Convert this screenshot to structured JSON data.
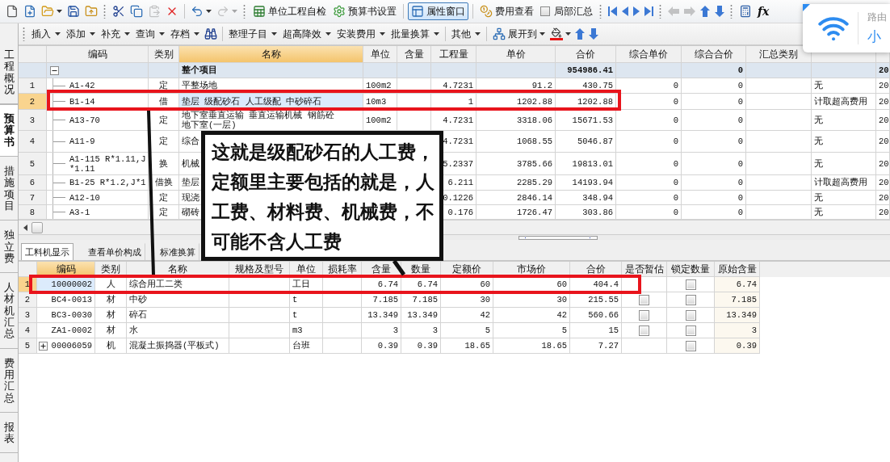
{
  "main_toolbar": [
    {
      "kind": "tool",
      "disabled": false
    },
    {
      "kind": "tool",
      "disabled": false
    },
    {
      "kind": "tool",
      "disabled": false,
      "menu": true
    },
    {
      "kind": "tool",
      "disabled": false
    },
    {
      "kind": "tool",
      "disabled": false
    },
    {
      "kind": "grip"
    },
    {
      "kind": "tool",
      "disabled": false
    },
    {
      "kind": "tool",
      "disabled": false
    },
    {
      "kind": "tool",
      "disabled": true
    },
    {
      "kind": "tool",
      "disabled": false
    },
    {
      "kind": "divider"
    },
    {
      "kind": "tool",
      "disabled": false,
      "menu": true
    },
    {
      "kind": "tool",
      "disabled": true,
      "menu": true
    },
    {
      "kind": "grip"
    },
    {
      "kind": "labeled",
      "label": "单位工程自检"
    },
    {
      "kind": "labeled",
      "label": "预算书设置"
    },
    {
      "kind": "divider"
    },
    {
      "kind": "toggle",
      "label": "属性窗口",
      "selected": true
    },
    {
      "kind": "divider"
    },
    {
      "kind": "labeled",
      "label": "费用查看"
    },
    {
      "kind": "check",
      "label": "局部汇总",
      "checked": false
    },
    {
      "kind": "grip"
    },
    {
      "kind": "tool",
      "disabled": false
    },
    {
      "kind": "tool",
      "disabled": false
    },
    {
      "kind": "tool",
      "disabled": false
    },
    {
      "kind": "tool",
      "disabled": false
    },
    {
      "kind": "grip"
    },
    {
      "kind": "tool",
      "disabled": true
    },
    {
      "kind": "tool",
      "disabled": true
    },
    {
      "kind": "tool",
      "disabled": false
    },
    {
      "kind": "tool",
      "disabled": false
    },
    {
      "kind": "grip"
    },
    {
      "kind": "tool",
      "disabled": false
    },
    {
      "kind": "text",
      "label": "fx"
    }
  ],
  "sub_toolbar": [
    {
      "kind": "grip"
    },
    {
      "kind": "menu",
      "label": "插入"
    },
    {
      "kind": "menu",
      "label": "添加"
    },
    {
      "kind": "menu",
      "label": "补充"
    },
    {
      "kind": "menu",
      "label": "查询"
    },
    {
      "kind": "menu",
      "label": "存档"
    },
    {
      "kind": "tool",
      "disabled": false
    },
    {
      "kind": "divider"
    },
    {
      "kind": "menu",
      "label": "整理子目"
    },
    {
      "kind": "menu",
      "label": "超高降效"
    },
    {
      "kind": "menu",
      "label": "安装费用"
    },
    {
      "kind": "menu",
      "label": "批量换算"
    },
    {
      "kind": "divider"
    },
    {
      "kind": "menu",
      "label": "其他"
    },
    {
      "kind": "divider"
    },
    {
      "kind": "labeled",
      "label": "展开到",
      "menu": true
    },
    {
      "kind": "tool",
      "disabled": false,
      "menu": true
    },
    {
      "kind": "tool",
      "disabled": false
    },
    {
      "kind": "tool",
      "disabled": false
    }
  ],
  "side_tabs": [
    {
      "label": "工程概况",
      "selected": false
    },
    {
      "label": "预算书",
      "selected": true
    },
    {
      "label": "措施项目",
      "selected": false
    },
    {
      "label": "独立费",
      "selected": false
    },
    {
      "label": "人材机汇总",
      "selected": false
    },
    {
      "label": "费用汇总",
      "selected": false
    },
    {
      "label": "报表",
      "selected": false
    }
  ],
  "budget_table": {
    "columns": [
      {
        "label": "编码",
        "selected": false
      },
      {
        "label": "类别",
        "selected": false
      },
      {
        "label": "名称",
        "selected": true
      },
      {
        "label": "单位",
        "selected": false
      },
      {
        "label": "含量",
        "selected": false
      },
      {
        "label": "工程量",
        "selected": false
      },
      {
        "label": "单价",
        "selected": false
      },
      {
        "label": "合价",
        "selected": false
      },
      {
        "label": "综合单价",
        "selected": false
      },
      {
        "label": "综合合价",
        "selected": false
      },
      {
        "label": "汇总类别",
        "selected": false
      }
    ],
    "summary_row": {
      "expanded": true,
      "name": "整个项目",
      "total": "954986.41",
      "comp_total": "0",
      "column_13": "20"
    },
    "rows": [
      {
        "no": "1",
        "selected": false,
        "code": "A1-42",
        "type": "定",
        "name": "平整场地",
        "unit": "100m2",
        "quantity": "4.7231",
        "price": "91.2",
        "total": "430.75",
        "comp_price": "0",
        "comp_total": "0",
        "column_12": "无",
        "column_13": "20"
      },
      {
        "no": "2",
        "selected": true,
        "code": "B1-14",
        "type": "借",
        "name": "垫层 级配砂石 人工级配 中砂碎石",
        "unit": "10m3",
        "quantity": "1",
        "price": "1202.88",
        "total": "1202.88",
        "comp_price": "0",
        "comp_total": "0",
        "column_12": "计取超高费用",
        "column_13": "20"
      },
      {
        "no": "3",
        "selected": false,
        "code": "A13-70",
        "type": "定",
        "name": "地下室垂直运输 垂直运输机械 钢筋砼地下室(一层)",
        "unit": "100m2",
        "quantity": "4.7231",
        "price": "3318.06",
        "total": "15671.53",
        "comp_price": "0",
        "comp_total": "0",
        "column_12": "无",
        "column_13": "20"
      },
      {
        "no": "4",
        "selected": false,
        "code": "A11-9",
        "type": "定",
        "name": "综合",
        "quantity": "4.7231",
        "price": "1068.55",
        "total": "5046.87",
        "comp_price": "0",
        "comp_total": "0",
        "column_12": "无",
        "column_13": "20"
      },
      {
        "no": "5",
        "selected": false,
        "code": "A1-115 R*1.11,J *1.11",
        "type": "换",
        "name": "机械",
        "quantity": "5.2337",
        "price": "3785.66",
        "total": "19813.01",
        "comp_price": "0",
        "comp_total": "0",
        "column_12": "无",
        "column_13": "20"
      },
      {
        "no": "6",
        "selected": false,
        "code": "B1-25 R*1.2,J*1",
        "type": "借换",
        "name": "垫层",
        "quantity": "6.211",
        "price": "2285.29",
        "total": "14193.94",
        "comp_price": "0",
        "comp_total": "0",
        "column_12": "计取超高费用",
        "column_13": "20"
      },
      {
        "no": "7",
        "selected": false,
        "code": "A12-10",
        "type": "定",
        "name": "现浇",
        "quantity": "0.1226",
        "price": "2846.14",
        "total": "348.94",
        "comp_price": "0",
        "comp_total": "0",
        "column_12": "无",
        "column_13": "20"
      },
      {
        "no": "8",
        "selected": false,
        "code": "A3-1",
        "type": "定",
        "name": "砌砖",
        "quantity": "0.176",
        "price": "1726.47",
        "total": "303.86",
        "comp_price": "0",
        "comp_total": "0",
        "column_12": "无",
        "column_13": "20"
      }
    ]
  },
  "resource_table": {
    "tabs": [
      {
        "label": "工料机显示",
        "selected": true
      },
      {
        "label": "查看单价构成",
        "selected": false
      },
      {
        "label": "标准换算",
        "selected": false
      }
    ],
    "columns": [
      {
        "label": "编码",
        "selected": true
      },
      {
        "label": "类别",
        "selected": false
      },
      {
        "label": "名称",
        "selected": false
      },
      {
        "label": "规格及型号",
        "selected": false
      },
      {
        "label": "单位",
        "selected": false
      },
      {
        "label": "损耗率",
        "selected": false
      },
      {
        "label": "含量",
        "selected": false
      },
      {
        "label": "数量",
        "selected": false
      },
      {
        "label": "定额价",
        "selected": false
      },
      {
        "label": "市场价",
        "selected": false
      },
      {
        "label": "合价",
        "selected": false
      },
      {
        "label": "是否暂估",
        "selected": false
      },
      {
        "label": "锁定数量",
        "selected": false
      },
      {
        "label": "原始含量",
        "selected": false
      }
    ],
    "rows": [
      {
        "no": "1",
        "selected": true,
        "code": "10000002",
        "type": "人",
        "name": "综合用工二类",
        "unit": "工日",
        "content": "6.74",
        "quantity": "6.74",
        "quota_price": "60",
        "market_price": "60",
        "total": "404.4",
        "locked": false,
        "original_content": "6.74"
      },
      {
        "no": "2",
        "selected": false,
        "code": "BC4-0013",
        "type": "材",
        "name": "中砂",
        "unit": "t",
        "content": "7.185",
        "quantity": "7.185",
        "quota_price": "30",
        "market_price": "30",
        "total": "215.55",
        "provisional": false,
        "locked": false,
        "original_content": "7.185"
      },
      {
        "no": "3",
        "selected": false,
        "code": "BC3-0030",
        "type": "材",
        "name": "碎石",
        "unit": "t",
        "content": "13.349",
        "quantity": "13.349",
        "quota_price": "42",
        "market_price": "42",
        "total": "560.66",
        "provisional": false,
        "locked": false,
        "original_content": "13.349"
      },
      {
        "no": "4",
        "selected": false,
        "code": "ZA1-0002",
        "type": "材",
        "name": "水",
        "unit": "m3",
        "content": "3",
        "quantity": "3",
        "quota_price": "5",
        "market_price": "5",
        "total": "15",
        "provisional": false,
        "locked": false,
        "original_content": "3"
      },
      {
        "no": "5",
        "selected": false,
        "expanded": false,
        "code": "00006059",
        "type": "机",
        "name": "混凝土振捣器(平板式)",
        "unit": "台班",
        "content": "0.39",
        "quantity": "0.39",
        "quota_price": "18.65",
        "market_price": "18.65",
        "total": "7.27",
        "locked": false,
        "original_content": "0.39"
      }
    ]
  },
  "annotation": {
    "note": "这就是级配砂石的人工费，定额里主要包括的就是，人工费、材料费、机械费，不可能不含人工费"
  },
  "wifi_popup": {
    "caption": "路由",
    "title": "小"
  }
}
